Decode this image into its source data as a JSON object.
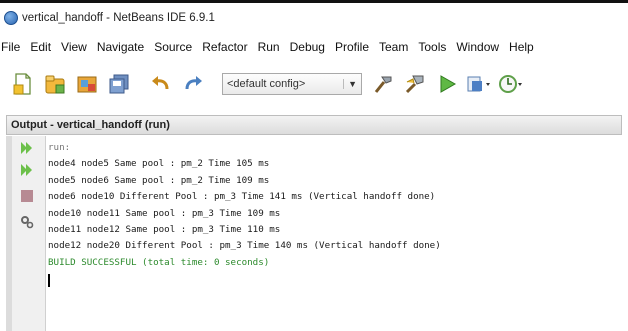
{
  "window": {
    "title": "vertical_handoff - NetBeans IDE 6.9.1"
  },
  "menubar": {
    "items": [
      "File",
      "Edit",
      "View",
      "Navigate",
      "Source",
      "Refactor",
      "Run",
      "Debug",
      "Profile",
      "Team",
      "Tools",
      "Window",
      "Help"
    ]
  },
  "toolbar": {
    "config_value": "<default config>",
    "icons": [
      "new-file-icon",
      "new-project-icon",
      "open-project-icon",
      "save-all-icon",
      "undo-icon",
      "redo-icon",
      "clean-build-icon",
      "build-icon",
      "run-icon",
      "debug-icon",
      "profile-icon"
    ]
  },
  "output": {
    "title": "Output - vertical_handoff (run)",
    "side_icons": [
      "rerun-icon",
      "rerun-with-options-icon",
      "stop-icon",
      "settings-icon"
    ],
    "lines": [
      "run:",
      "node4 node5 Same pool : pm_2 Time 105 ms",
      "node5 node6 Same pool : pm_2 Time 109 ms",
      "node6 node10 Different Pool : pm_3 Time 141 ms (Vertical handoff done)",
      "node10 node11 Same pool : pm_3 Time 109 ms",
      "node11 node12 Same pool : pm_3 Time 110 ms",
      "node12 node20 Different Pool : pm_3 Time 140 ms (Vertical handoff done)",
      "BUILD SUCCESSFUL (total time: 0 seconds)"
    ]
  },
  "colors": {
    "success_text": "#2c8a2c",
    "muted_text": "#777777"
  }
}
